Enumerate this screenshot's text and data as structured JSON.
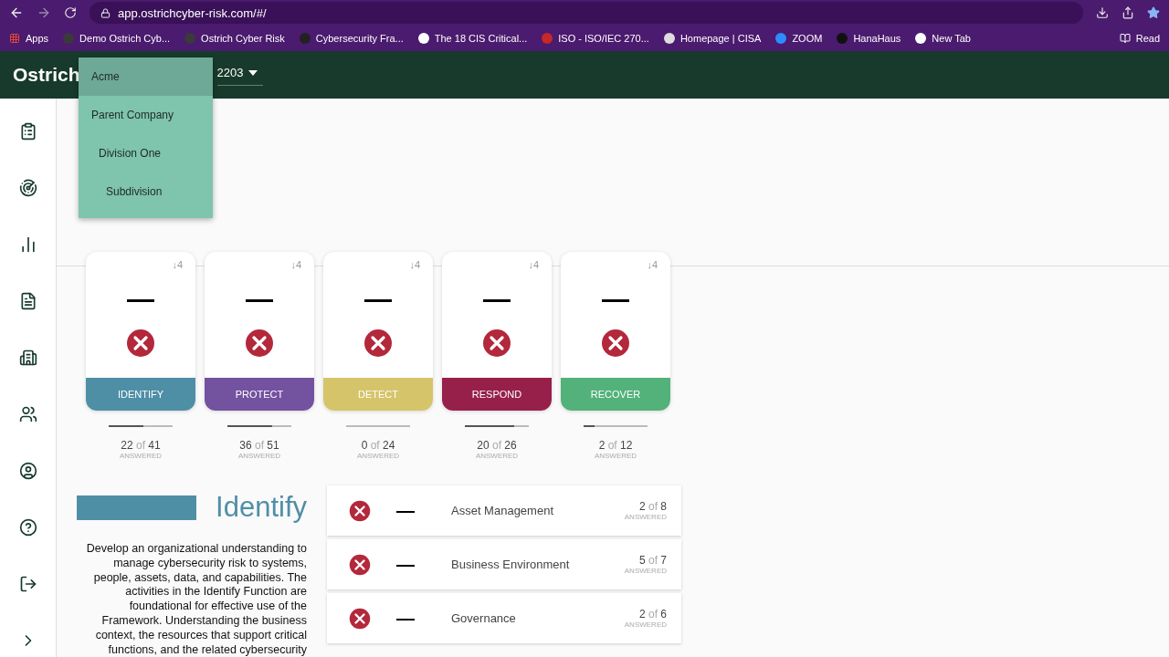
{
  "browser": {
    "url": "app.ostrichcyber-risk.com/#/",
    "bookmarks": [
      {
        "label": "Apps"
      },
      {
        "label": "Demo Ostrich Cyb...",
        "color": "#3a3a3a"
      },
      {
        "label": "Ostrich Cyber Risk",
        "color": "#3a3a3a"
      },
      {
        "label": "Cybersecurity Fra...",
        "color": "#222222"
      },
      {
        "label": "The 18 CIS Critical...",
        "color": "#ffffff"
      },
      {
        "label": "ISO - ISO/IEC 270...",
        "color": "#c62828"
      },
      {
        "label": "Homepage | CISA",
        "color": "#dddddd"
      },
      {
        "label": "ZOOM",
        "color": "#2d8cff"
      },
      {
        "label": "HanaHaus",
        "color": "#111111"
      },
      {
        "label": "New Tab",
        "color": "#ffffff"
      },
      {
        "label": "Read"
      }
    ]
  },
  "header": {
    "logo": "Ostrich",
    "selector_value": "2203"
  },
  "org_menu": {
    "items": [
      {
        "label": "Acme",
        "selected": true
      },
      {
        "label": "Parent Company",
        "selected": false,
        "children": [
          {
            "label": "Division One",
            "selected": false,
            "children": [
              {
                "label": "Subdivision",
                "selected": false
              }
            ]
          }
        ]
      }
    ]
  },
  "functions": [
    {
      "name": "IDENTIFY",
      "color": "#4f8fa6",
      "score": "—",
      "badge": "↓4",
      "answered": "22",
      "of": "of",
      "total": "41",
      "caption": "ANSWERED",
      "level": 0.54
    },
    {
      "name": "PROTECT",
      "color": "#7352a0",
      "score": "—",
      "badge": "↓4",
      "answered": "36",
      "of": "of",
      "total": "51",
      "caption": "ANSWERED",
      "level": 0.7
    },
    {
      "name": "DETECT",
      "color": "#d6c46a",
      "score": "—",
      "badge": "↓4",
      "answered": "0",
      "of": "of",
      "total": "24",
      "caption": "ANSWERED",
      "level": 0
    },
    {
      "name": "RESPOND",
      "color": "#96204a",
      "score": "—",
      "badge": "↓4",
      "answered": "20",
      "of": "of",
      "total": "26",
      "caption": "ANSWERED",
      "level": 0.77
    },
    {
      "name": "RECOVER",
      "color": "#52b27a",
      "score": "—",
      "badge": "↓4",
      "answered": "2",
      "of": "of",
      "total": "12",
      "caption": "ANSWERED",
      "level": 0.17
    }
  ],
  "detail": {
    "title": "Identify",
    "color": "#4f8fa6",
    "description": "Develop an organizational understanding to manage cybersecurity risk to systems, people, assets, data, and capabilities. The activities in the Identify Function are foundational for effective use of the Framework. Understanding the business context, the resources that support critical functions, and the related cybersecurity",
    "categories": [
      {
        "name": "Asset Management",
        "score": "—",
        "answered": "2",
        "of": "of",
        "total": "8",
        "caption": "ANSWERED"
      },
      {
        "name": "Business Environment",
        "score": "—",
        "answered": "5",
        "of": "of",
        "total": "7",
        "caption": "ANSWERED"
      },
      {
        "name": "Governance",
        "score": "—",
        "answered": "2",
        "of": "of",
        "total": "6",
        "caption": "ANSWERED"
      }
    ]
  }
}
